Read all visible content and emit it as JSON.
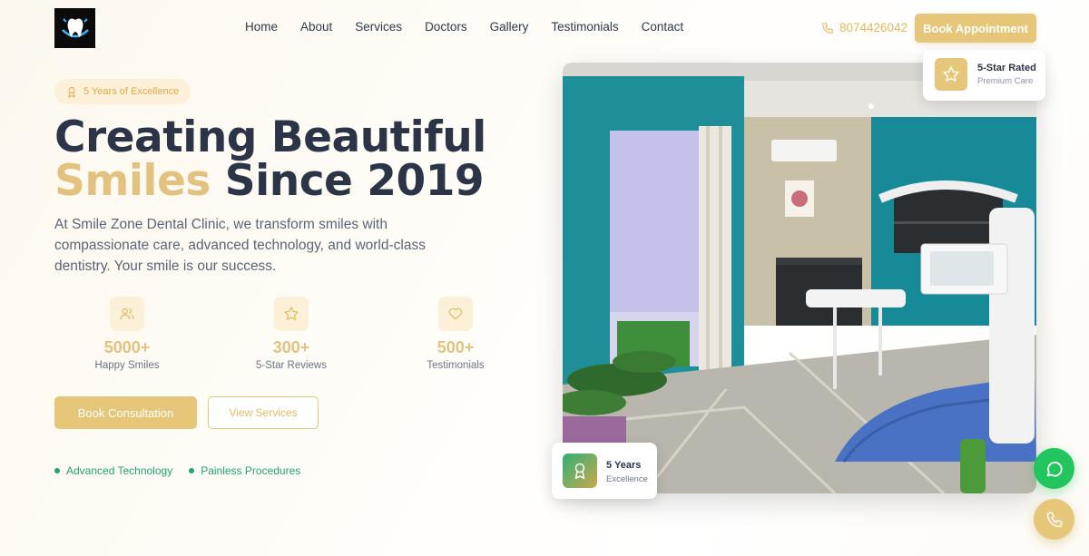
{
  "nav": {
    "links": [
      "Home",
      "About",
      "Services",
      "Doctors",
      "Gallery",
      "Testimonials",
      "Contact"
    ],
    "phone": "8074426042",
    "book_label": "Book Appointment"
  },
  "hero": {
    "badge": "5 Years of Excellence",
    "title_line1": "Creating Beautiful",
    "title_accent": "Smiles",
    "title_rest": " Since 2019",
    "description": "At Smile Zone Dental Clinic, we transform smiles with compassionate care, advanced technology, and world-class dentistry. Your smile is our success.",
    "stats": [
      {
        "value": "5000+",
        "label": "Happy Smiles",
        "icon": "users-icon"
      },
      {
        "value": "300+",
        "label": "5-Star Reviews",
        "icon": "star-icon"
      },
      {
        "value": "500+",
        "label": "Testimonials",
        "icon": "heart-icon"
      }
    ],
    "primary_button": "Book Consultation",
    "secondary_button": "View Services",
    "features": [
      "Advanced Technology",
      "Painless Procedures"
    ]
  },
  "cards": {
    "rated_title": "5-Star Rated",
    "rated_sub": "Premium Care",
    "years_title": "5 Years",
    "years_sub": "Excellence"
  },
  "colors": {
    "gold": "#e6c678",
    "navy": "#2b3547",
    "green": "#22c55e",
    "feature_green": "#1fa56b"
  }
}
